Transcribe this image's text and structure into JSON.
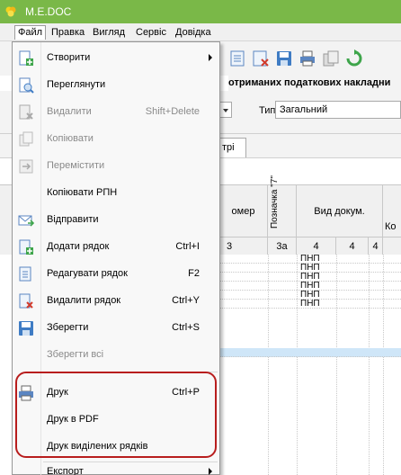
{
  "app": {
    "title": "M.E.DOC"
  },
  "menubar": {
    "items": [
      "Файл",
      "Правка",
      "Вигляд",
      "Сервіс",
      "Довідка"
    ]
  },
  "header": {
    "title": "отриманих податкових накладни",
    "type_label": "Тип",
    "type_value": "Загальний",
    "tab_label": "трі"
  },
  "grid": {
    "col_nomer": "омер",
    "col_poznachka": "Позначка \"7\"",
    "col_vyd": "Вид докум.",
    "col_ko": "Ко",
    "num_3": "3",
    "num_3a": "3а",
    "num_4a": "4",
    "num_4b": "4",
    "num_4c": "4",
    "rows": [
      "ПНП",
      "ПНП",
      "ПНП",
      "ПНП",
      "ПНП",
      "ПНП"
    ]
  },
  "file_menu": {
    "create": "Створити",
    "view": "Переглянути",
    "delete": "Видалити",
    "delete_shortcut": "Shift+Delete",
    "copy": "Копіювати",
    "move": "Перемістити",
    "copy_rpn": "Копіювати РПН",
    "send": "Відправити",
    "add_row": "Додати рядок",
    "add_row_shortcut": "Ctrl+I",
    "edit_row": "Редагувати рядок",
    "edit_row_shortcut": "F2",
    "delete_row": "Видалити рядок",
    "delete_row_shortcut": "Ctrl+Y",
    "save": "Зберегти",
    "save_shortcut": "Ctrl+S",
    "save_all": "Зберегти всі",
    "print": "Друк",
    "print_shortcut": "Ctrl+P",
    "print_pdf": "Друк в PDF",
    "print_selected": "Друк виділених рядків",
    "export": "Експорт"
  },
  "colors": {
    "titlebar": "#7ab848",
    "highlight": "#b81d1d",
    "selection": "#cfe6f8"
  }
}
